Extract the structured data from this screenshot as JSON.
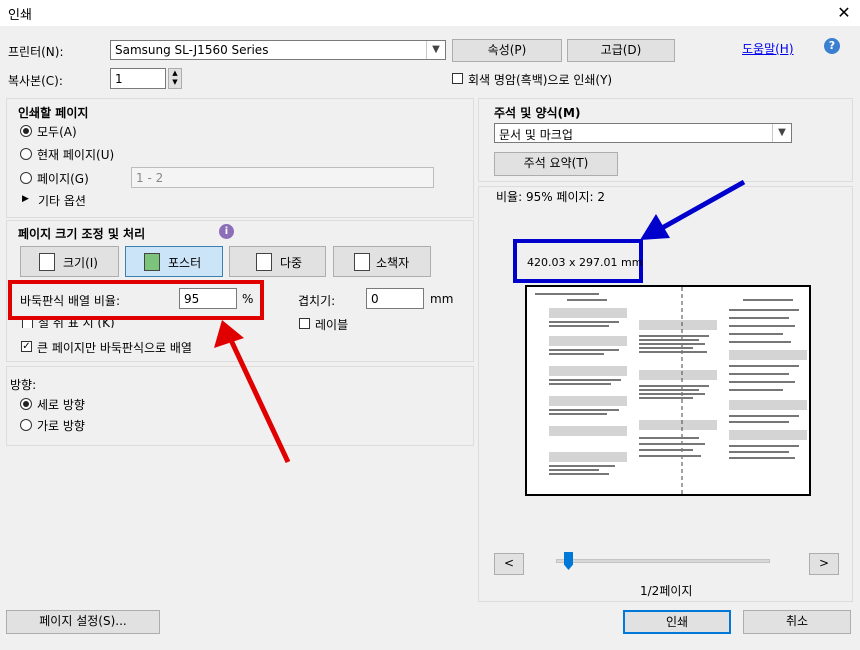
{
  "window": {
    "title": "인쇄",
    "close_glyph": "✕"
  },
  "printer": {
    "label": "프린터(N):",
    "selected": "Samsung SL-J1560 Series",
    "properties_button": "속성(P)",
    "advanced_button": "고급(D)",
    "help_link": "도움말(H)",
    "help_icon_glyph": "?"
  },
  "copies": {
    "label": "복사본(C):",
    "value": "1"
  },
  "grayscale": {
    "label": "회색 명암(흑백)으로 인쇄(Y)",
    "checked": false
  },
  "pages_to_print": {
    "heading": "인쇄할 페이지",
    "all": "모두(A)",
    "current": "현재 페이지(U)",
    "pages": "페이지(G)",
    "pages_placeholder": "1 - 2",
    "more_options": "기타 옵션",
    "selected": "all"
  },
  "page_sizing": {
    "heading": "페이지 크기 조정 및 처리",
    "info_glyph": "i",
    "tabs": [
      "크기(I)",
      "포스터",
      "다중",
      "소책자"
    ],
    "active_tab": "포스터",
    "tile_scale_label": "바둑판식 배열 비율:",
    "tile_scale_value": "95",
    "tile_scale_unit": "%",
    "overlap_label": "겹치기:",
    "overlap_value": "0",
    "overlap_unit": "mm",
    "labels_label": "레이블",
    "cut_marks_partial": "절 취 표 시 (K)",
    "large_pages_only_label": "큰 페이지만 바둑판식으로 배열",
    "large_pages_only_checked": true
  },
  "orientation": {
    "heading": "방향:",
    "portrait": "세로 방향",
    "landscape": "가로 방향",
    "selected": "portrait"
  },
  "comments_forms": {
    "heading": "주석 및 양식(M)",
    "selected": "문서 및 마크업",
    "summarize_button": "주석 요약(T)"
  },
  "preview": {
    "scale_text": "비율:  95% 페이지: 2",
    "size_label": "420.03 x 297.01 mm",
    "page_indicator": "1/2페이지",
    "prev_glyph": "<",
    "next_glyph": ">",
    "slider_fraction": 0.0
  },
  "footer": {
    "page_setup_button": "페이지 설정(S)...",
    "print_button": "인쇄",
    "cancel_button": "취소"
  },
  "annotations": {
    "red_color": "#e00000",
    "blue_color": "#0000cc"
  }
}
